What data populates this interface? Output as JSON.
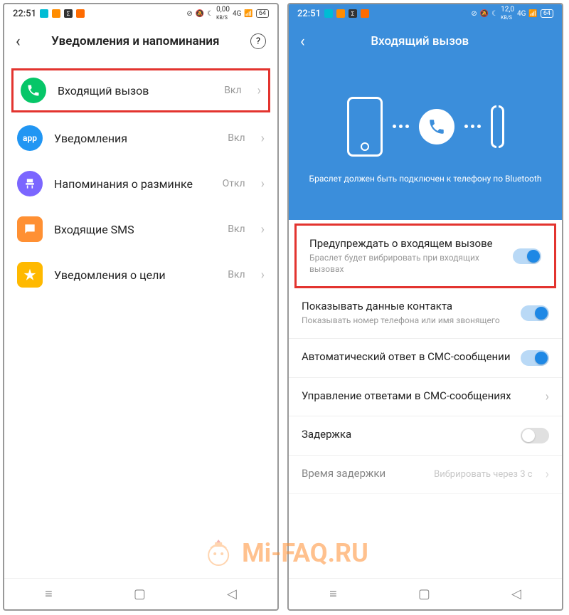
{
  "left": {
    "status": {
      "time": "22:51",
      "data": "0,00",
      "data_unit": "KB/S",
      "net": "4G",
      "battery": "64"
    },
    "header": {
      "title": "Уведомления и напоминания",
      "help": "?"
    },
    "items": [
      {
        "label": "Входящий вызов",
        "value": "Вкл"
      },
      {
        "label": "Уведомления",
        "value": "Вкл"
      },
      {
        "label": "Напоминания о разминке",
        "value": "Откл"
      },
      {
        "label": "Входящие SMS",
        "value": "Вкл"
      },
      {
        "label": "Уведомления о цели",
        "value": "Вкл"
      }
    ]
  },
  "right": {
    "status": {
      "time": "22:51",
      "data": "12,0",
      "data_unit": "KB/S",
      "net": "4G",
      "battery": "64"
    },
    "header": {
      "title": "Входящий вызов"
    },
    "hero_text": "Браслет должен быть подключен к телефону по Bluetooth",
    "settings": [
      {
        "title": "Предупреждать о входящем вызове",
        "sub": "Браслет будет вибрировать при входящих вызовах",
        "toggle": true
      },
      {
        "title": "Показывать данные контакта",
        "sub": "Показывать номер телефона или имя звонящего",
        "toggle": true
      },
      {
        "title": "Автоматический ответ в СМС-сообщении",
        "sub": "",
        "toggle": true
      },
      {
        "title": "Управление ответами в СМС-сообщениях",
        "sub": "",
        "chevron": true
      },
      {
        "title": "Задержка",
        "sub": "",
        "toggle": false
      },
      {
        "title": "Время задержки",
        "sub": "",
        "value": "Вибрировать через 3 с",
        "chevron": true
      }
    ]
  },
  "watermark": "Mi-FAQ.RU",
  "icons": {
    "app_label": "app"
  }
}
